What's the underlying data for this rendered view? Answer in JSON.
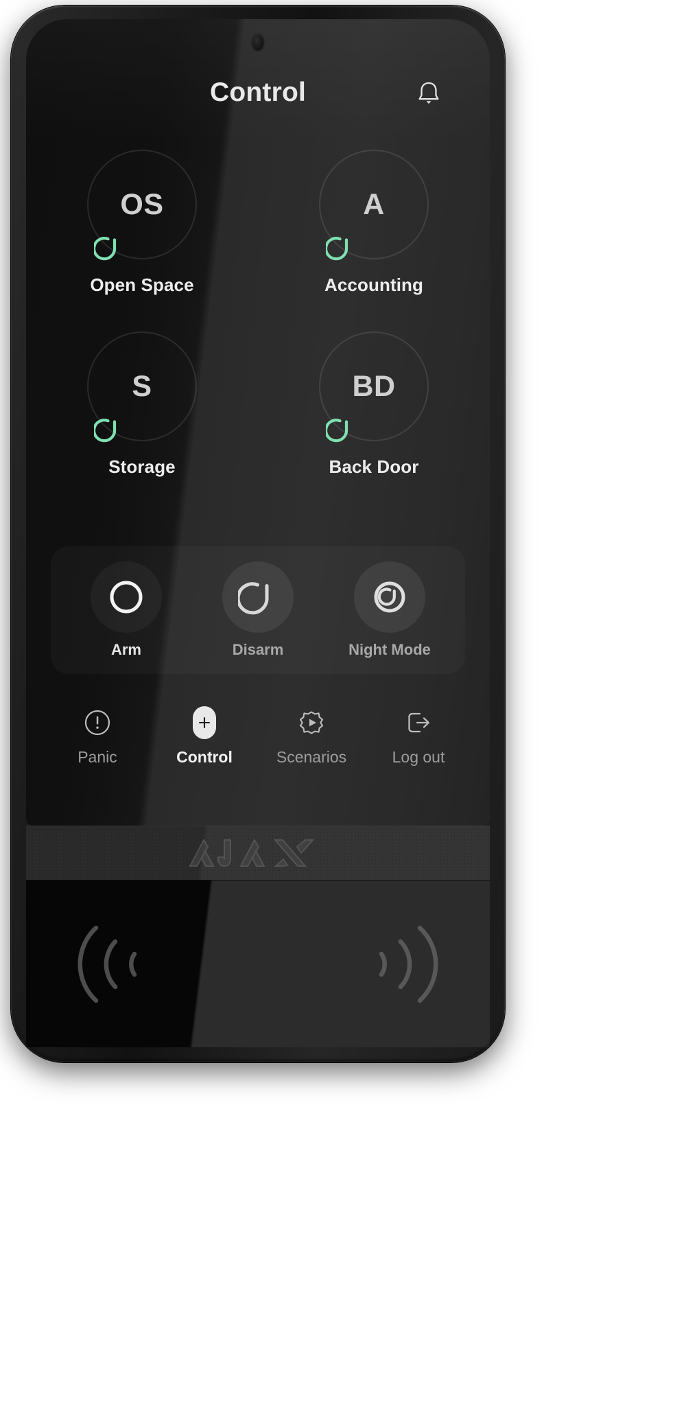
{
  "device": {
    "brand_logo": "AJAX",
    "reader_icon_left": "rfid-wave-icon",
    "reader_icon_right": "rfid-wave-icon",
    "sensor_icon": "proximity-sensor"
  },
  "header": {
    "title": "Control",
    "bell_icon": "bell-icon"
  },
  "groups": [
    {
      "initials": "OS",
      "label": "Open Space",
      "status": "disarmed",
      "status_icon": "disarmed-arc-icon"
    },
    {
      "initials": "A",
      "label": "Accounting",
      "status": "disarmed",
      "status_icon": "disarmed-arc-icon"
    },
    {
      "initials": "S",
      "label": "Storage",
      "status": "disarmed",
      "status_icon": "disarmed-arc-icon"
    },
    {
      "initials": "BD",
      "label": "Back Door",
      "status": "disarmed",
      "status_icon": "disarmed-arc-icon"
    }
  ],
  "modes": [
    {
      "label": "Arm",
      "icon": "arm-ring-icon",
      "active": true
    },
    {
      "label": "Disarm",
      "icon": "disarm-arc-icon",
      "active": false
    },
    {
      "label": "Night Mode",
      "icon": "night-mode-icon",
      "active": false
    }
  ],
  "nav": [
    {
      "label": "Panic",
      "icon": "panic-exclamation-icon",
      "active": false
    },
    {
      "label": "Control",
      "icon": "plus-pill-icon",
      "active": true
    },
    {
      "label": "Scenarios",
      "icon": "gear-play-icon",
      "active": false
    },
    {
      "label": "Log out",
      "icon": "logout-arrow-icon",
      "active": false
    }
  ],
  "colors": {
    "status_green": "#7FE0B2",
    "screen_black": "#0a0a0a",
    "text_primary": "#ededed",
    "text_muted": "#9d9d9d",
    "accent_white": "#e8e8e8"
  }
}
